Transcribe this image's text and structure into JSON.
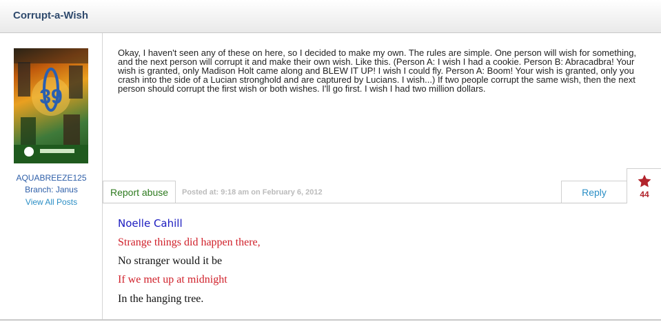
{
  "header": {
    "title": "Corrupt-a-Wish"
  },
  "author": {
    "username": "AQUABREEZE125",
    "branch": "Branch: Janus",
    "view_posts_label": "View All Posts"
  },
  "post": {
    "body": "Okay, I haven't seen any of these on here, so I decided to make my own. The rules are simple. One person will wish for something, and the next person will corrupt it and make their own wish. Like this. (Person A: I wish I had a cookie. Person B: Abracadbra! Your wish is granted, only Madison Holt came along and BLEW IT UP! I wish I could fly. Person A: Boom! Your wish is granted, only you crash into the side of a Lucian stronghold and are captured by Lucians. I wish...) If two people corrupt the same wish, then the next person should corrupt the first wish or both wishes. I'll go first. I wish I had two million dollars.",
    "posted_at": "Posted at: 9:18 am on February 6, 2012",
    "report_label": "Report abuse",
    "reply_label": "Reply",
    "star_count": "44"
  },
  "signature": {
    "name": "Noelle Cahill",
    "lines": [
      "Strange things did happen there,",
      "No stranger would it be",
      "If we met up at midnight",
      "In the hanging tree."
    ]
  },
  "colors": {
    "title": "#2f4a6d",
    "link": "#2a8ec5",
    "report": "#2d7a1e",
    "star": "#b2242c",
    "sig_red": "#d0202a",
    "sig_blue": "#1a1abf"
  },
  "icons": {
    "star": "star-icon",
    "avatar": "avatar-image"
  }
}
